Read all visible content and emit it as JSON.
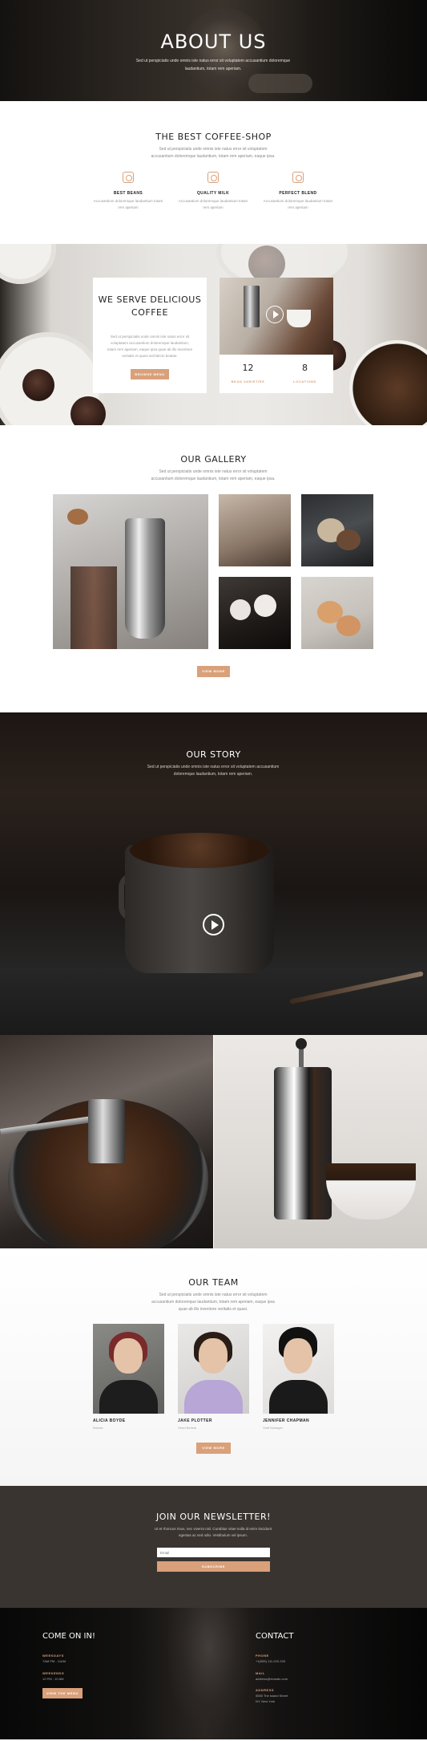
{
  "hero": {
    "title": "ABOUT US",
    "subtitle": "Sed ut perspiciatis unde omnis iste natus error sit voluptatem accusantium doloremque laudantium, totam rem aperiam."
  },
  "features": {
    "title": "THE BEST COFFEE-SHOP",
    "subtitle": "Sed ut perspiciatis unde omnis iste natus error sit voluptatem accusantium doloremque laudantium, totam rem aperiam, eaque ipsa.",
    "items": [
      {
        "title": "BEST BEANS",
        "desc": "Accusantium doloremque laudantium totam rem aperiam",
        "icon": "bean-icon"
      },
      {
        "title": "QUALITY MILK",
        "desc": "Accusantium doloremque laudantium totam rem aperiam",
        "icon": "milk-icon"
      },
      {
        "title": "PERFECT BLEND",
        "desc": "Accusantium doloremque laudantium totam rem aperiam",
        "icon": "blend-icon"
      }
    ]
  },
  "serve": {
    "title_line1": "WE SERVE DELICIOUS",
    "title_line2": "COFFEE",
    "text": "Sed ut perspiciatis unde omnis iste natus error sit voluptatem accusantium doloremque laudantium, totam rem aperiam, eaque ipsa quae ab illo inventore veritatis et quasi architecto beatae.",
    "button": "BROWSE MENU",
    "stats": [
      {
        "number": "12",
        "label": "BEAN VARIETIES"
      },
      {
        "number": "8",
        "label": "LOCATIONS"
      }
    ]
  },
  "gallery": {
    "title": "OUR GALLERY",
    "subtitle": "Sed ut perspiciatis unde omnis iste natus error sit voluptatem accusantium doloremque laudantium, totam rem aperiam, eaque ipsa.",
    "button": "VIEW MORE"
  },
  "story": {
    "title": "OUR STORY",
    "subtitle": "Sed ut perspiciatis unde omnis iste natus error sit voluptatem accusantium doloremque laudantium, totam rem aperiam."
  },
  "team": {
    "title": "OUR TEAM",
    "subtitle": "Sed ut perspiciatis unde omnis iste natus error sit voluptatem accusantium doloremque laudantium, totam rem aperiam, eaque ipsa quae ab illo inventore veritatis et quasi.",
    "members": [
      {
        "name": "ALICIA BOYDE",
        "role": "Barista"
      },
      {
        "name": "JAKE PLOTTER",
        "role": "Head Barista"
      },
      {
        "name": "JENNIFER CHAPMAN",
        "role": "Staff Manager"
      }
    ],
    "button": "VIEW MORE"
  },
  "newsletter": {
    "title": "JOIN OUR NEWSLETTER!",
    "subtitle": "Ut et rhoncus risus, nec viverra nisl. Curabitur vitae nulla id enim tincidunt egestas ac sed odio. Vestibulum vel ipsum.",
    "email_placeholder": "Email",
    "button": "SUBSCRIBE"
  },
  "footer": {
    "left_title": "COME ON IN!",
    "weekdays_label": "WEEKDAYS",
    "weekdays_hours": "7AM PM - 11AM",
    "weekends_label": "WEEKENDS",
    "weekends_hours": "12 PM - 10 AM",
    "button": "VIEW THE MENU",
    "right_title": "CONTACT",
    "phone_label": "PHONE",
    "phone": "+1(555) 111-222-333",
    "mail_label": "MAIL",
    "mail": "address@domain.com",
    "address_label": "ADDRESS",
    "address_line1": "5555 The Island Street",
    "address_line2": "NY, New York"
  }
}
